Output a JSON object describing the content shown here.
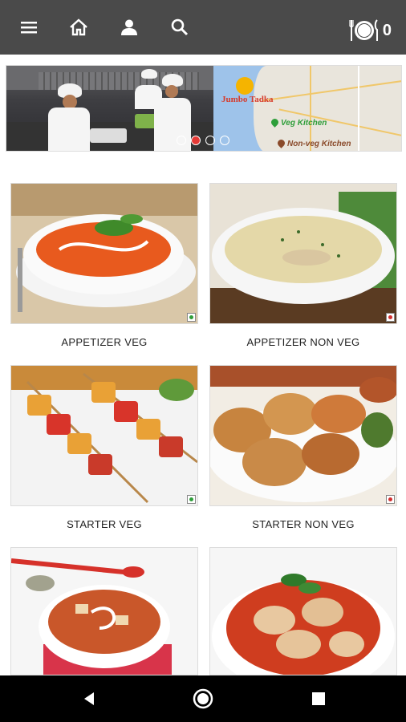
{
  "toolbar": {
    "icons": [
      "menu-icon",
      "home-icon",
      "profile-icon",
      "search-icon",
      "cart-icon"
    ],
    "cart_count": "0",
    "background": "#4a4a4a"
  },
  "banner": {
    "brand": "Jumbo Tadka",
    "veg_kitchen": "Veg Kitchen",
    "nonveg_kitchen": "Non-veg Kitchen",
    "slides": 4,
    "active_slide": 2
  },
  "categories": [
    {
      "label": "APPETIZER VEG",
      "type": "veg"
    },
    {
      "label": "APPETIZER NON VEG",
      "type": "non-veg"
    },
    {
      "label": "STARTER VEG",
      "type": "veg"
    },
    {
      "label": "STARTER NON VEG",
      "type": "non-veg"
    },
    {
      "label": "",
      "type": "veg"
    },
    {
      "label": "",
      "type": "non-veg"
    }
  ],
  "colors": {
    "veg": "#2e9e3a",
    "non_veg": "#d32f2f",
    "accent": "#e53935"
  },
  "navbar": {
    "icons": [
      "back-icon",
      "home-circle-icon",
      "recents-icon"
    ]
  }
}
